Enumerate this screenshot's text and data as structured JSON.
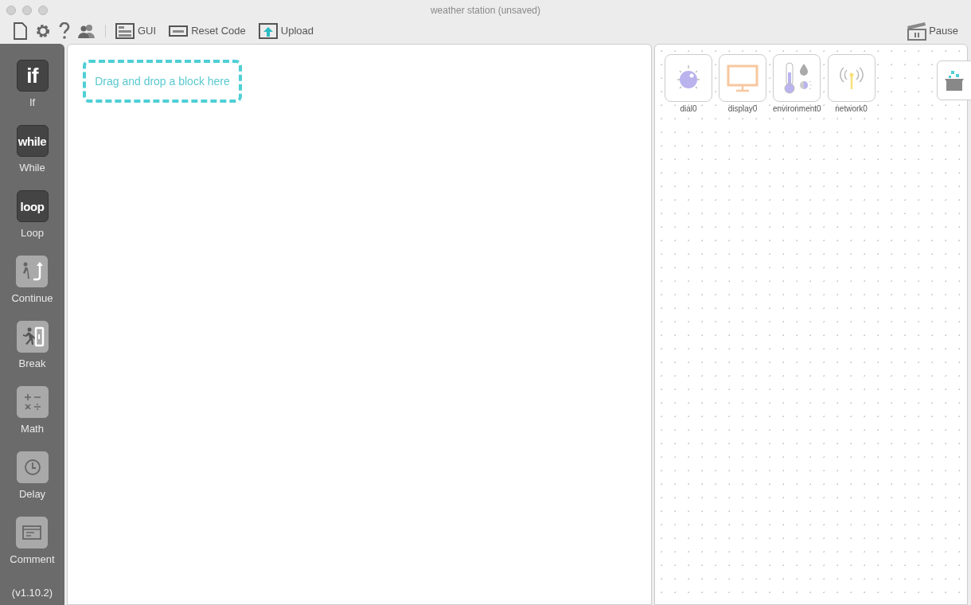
{
  "window": {
    "title": "weather station (unsaved)"
  },
  "toolbar": {
    "buttons": [
      {
        "kind": "gui",
        "label": "GUI"
      },
      {
        "kind": "reset",
        "label": "Reset Code"
      },
      {
        "kind": "upload",
        "label": "Upload"
      }
    ],
    "pause": {
      "label": "Pause"
    }
  },
  "blocks": [
    {
      "kind": "text",
      "glyph": "if",
      "label": "If"
    },
    {
      "kind": "text",
      "glyph": "while",
      "label": "While"
    },
    {
      "kind": "text",
      "glyph": "loop",
      "label": "Loop"
    },
    {
      "kind": "continue",
      "label": "Continue"
    },
    {
      "kind": "break",
      "label": "Break"
    },
    {
      "kind": "math",
      "label": "Math"
    },
    {
      "kind": "delay",
      "label": "Delay"
    },
    {
      "kind": "comment",
      "label": "Comment"
    }
  ],
  "version": "(v1.10.2)",
  "canvas": {
    "drop_hint": "Drag and drop a block here"
  },
  "devices": [
    {
      "kind": "dial",
      "label": "dial0"
    },
    {
      "kind": "display",
      "label": "display0"
    },
    {
      "kind": "environment",
      "label": "environment0"
    },
    {
      "kind": "network",
      "label": "network0"
    }
  ]
}
